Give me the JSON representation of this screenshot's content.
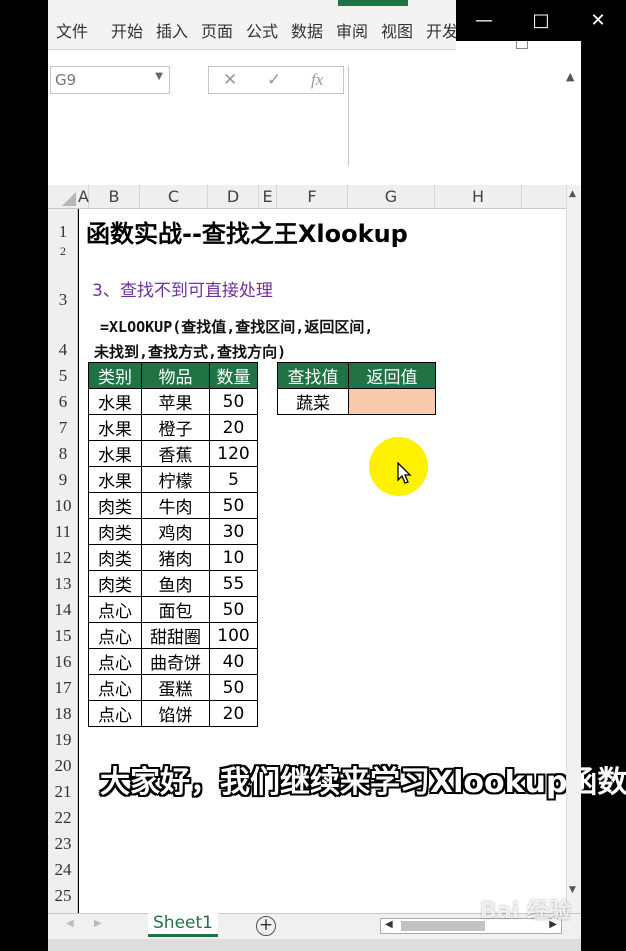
{
  "ribbon": {
    "tabs": [
      "文件",
      "开始",
      "插入",
      "页面",
      "公式",
      "数据",
      "审阅",
      "视图",
      "开发"
    ]
  },
  "namebox": {
    "value": "G9"
  },
  "formula_buttons": {
    "cancel": "✕",
    "enter": "✓",
    "fx": "fx"
  },
  "columns": [
    "A",
    "B",
    "C",
    "D",
    "E",
    "F",
    "G",
    "H"
  ],
  "rows": [
    "1",
    "2",
    "3",
    "4",
    "5",
    "6",
    "7",
    "8",
    "9",
    "10",
    "11",
    "12",
    "13",
    "14",
    "15",
    "16",
    "17",
    "18",
    "19",
    "20",
    "21",
    "22",
    "23",
    "24",
    "25"
  ],
  "sheet": {
    "title": "函数实战--查找之王Xlookup",
    "subtitle": "3、查找不到可直接处理",
    "formula_line1": "=XLOOKUP(查找值,查找区间,返回区间,",
    "formula_line2": "未找到,查找方式,查找方向)"
  },
  "main_table": {
    "headers": [
      "类别",
      "物品",
      "数量"
    ],
    "rows": [
      [
        "水果",
        "苹果",
        "50"
      ],
      [
        "水果",
        "橙子",
        "20"
      ],
      [
        "水果",
        "香蕉",
        "120"
      ],
      [
        "水果",
        "柠檬",
        "5"
      ],
      [
        "肉类",
        "牛肉",
        "50"
      ],
      [
        "肉类",
        "鸡肉",
        "30"
      ],
      [
        "肉类",
        "猪肉",
        "10"
      ],
      [
        "肉类",
        "鱼肉",
        "55"
      ],
      [
        "点心",
        "面包",
        "50"
      ],
      [
        "点心",
        "甜甜圈",
        "100"
      ],
      [
        "点心",
        "曲奇饼",
        "40"
      ],
      [
        "点心",
        "蛋糕",
        "50"
      ],
      [
        "点心",
        "馅饼",
        "20"
      ]
    ]
  },
  "lookup_table": {
    "headers": [
      "查找值",
      "返回值"
    ],
    "lookup_value": "蔬菜",
    "result": ""
  },
  "overlay_caption": "大家好，我们继续来学习Xlookup函数",
  "sheet_tabs": {
    "active": "Sheet1",
    "add": "+"
  },
  "watermark": "Bai 经验",
  "colors": {
    "header_green": "#217346",
    "result_fill": "#f8cbad",
    "subtitle_purple": "#7030a0",
    "cursor_highlight": "#fff200"
  }
}
